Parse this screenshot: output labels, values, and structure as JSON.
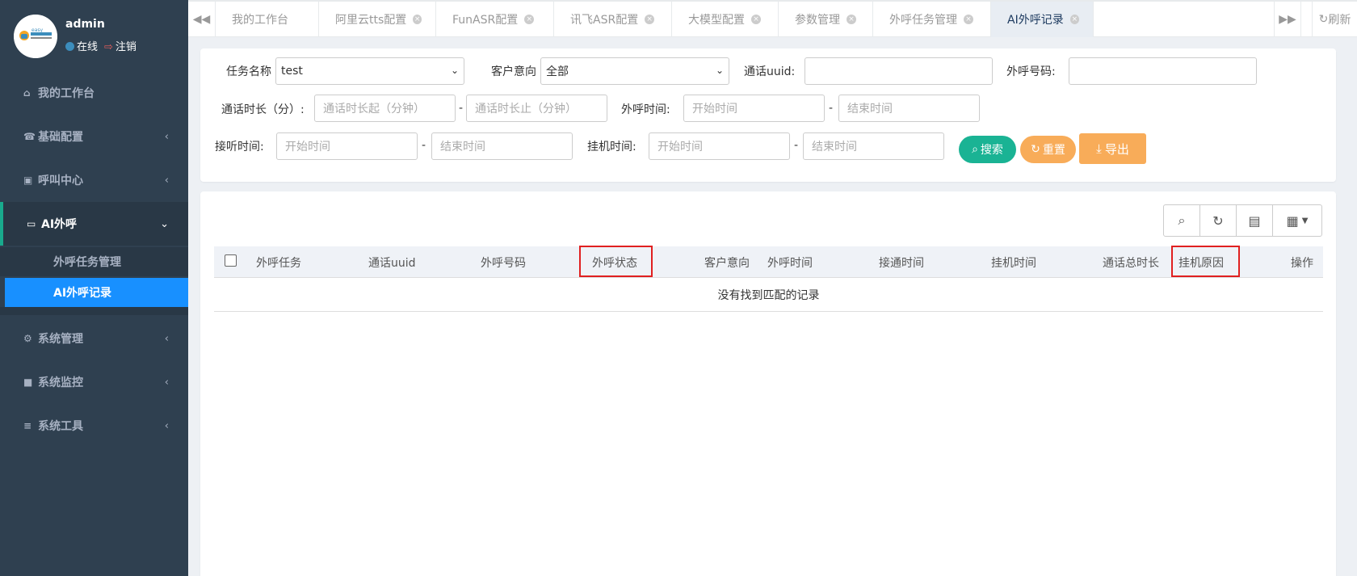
{
  "sidebar": {
    "user": {
      "name": "admin",
      "status": "在线",
      "logout": "注销",
      "logo_text": "easy"
    },
    "items": [
      {
        "label": "我的工作台"
      },
      {
        "label": "基础配置"
      },
      {
        "label": "呼叫中心"
      },
      {
        "label": "AI外呼"
      },
      {
        "label": "系统管理"
      },
      {
        "label": "系统监控"
      },
      {
        "label": "系统工具"
      }
    ],
    "sub_items": [
      {
        "label": "外呼任务管理"
      },
      {
        "label": "AI外呼记录"
      }
    ]
  },
  "tabs": [
    {
      "label": "我的工作台"
    },
    {
      "label": "阿里云tts配置"
    },
    {
      "label": "FunASR配置"
    },
    {
      "label": "讯飞ASR配置"
    },
    {
      "label": "大模型配置"
    },
    {
      "label": "参数管理"
    },
    {
      "label": "外呼任务管理"
    },
    {
      "label": "AI外呼记录"
    }
  ],
  "tab_refresh": "刷新",
  "filters": {
    "task_name_label": "任务名称",
    "task_name_value": "test",
    "intent_label": "客户意向",
    "intent_value": "全部",
    "uuid_label": "通话uuid:",
    "phone_label": "外呼号码:",
    "duration_label": "通话时长（分）:",
    "duration_from_ph": "通话时长起（分钟）",
    "duration_to_ph": "通话时长止（分钟）",
    "call_time_label": "外呼时间:",
    "answer_time_label": "接听时间:",
    "hangup_time_label": "挂机时间:",
    "start_ph": "开始时间",
    "end_ph": "结束时间",
    "dash": "-"
  },
  "buttons": {
    "search": "搜索",
    "reset": "重置",
    "export": "导出"
  },
  "table": {
    "columns": [
      "外呼任务",
      "通话uuid",
      "外呼号码",
      "外呼状态",
      "客户意向",
      "外呼时间",
      "接通时间",
      "挂机时间",
      "通话总时长",
      "挂机原因",
      "操作"
    ],
    "empty_text": "没有找到匹配的记录"
  },
  "colors": {
    "sidebar": "#2f4050",
    "active_sub": "#1890ff",
    "search": "#1ab394",
    "reset_export": "#f8ac59",
    "highlight": "#e02020"
  }
}
